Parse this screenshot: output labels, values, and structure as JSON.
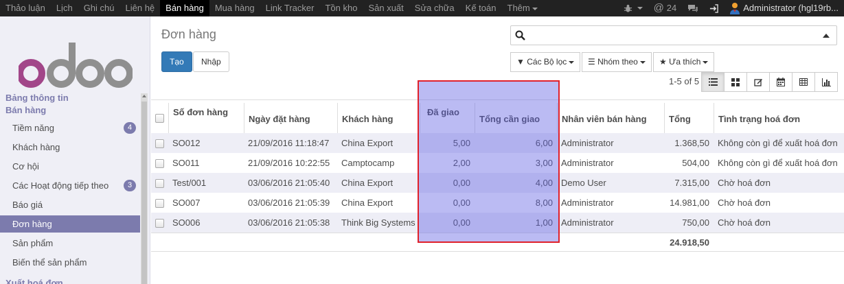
{
  "topmenu": {
    "items": [
      "Thảo luận",
      "Lịch",
      "Ghi chú",
      "Liên hệ",
      "Bán hàng",
      "Mua hàng",
      "Link Tracker",
      "Tồn kho",
      "Sản xuất",
      "Sửa chữa",
      "Kế toán",
      "Thêm"
    ],
    "active_index": 4,
    "messages_count": "24",
    "user": "Administrator (hgl19rb..."
  },
  "sidebar": {
    "sections": [
      "Bảng thông tin",
      "Bán hàng",
      "Xuất hoá đơn"
    ],
    "items": [
      {
        "label": "Tiềm năng",
        "badge": "4"
      },
      {
        "label": "Khách hàng"
      },
      {
        "label": "Cơ hội"
      },
      {
        "label": "Các Hoạt động tiếp theo",
        "badge": "3"
      },
      {
        "label": "Báo giá"
      },
      {
        "label": "Đơn hàng",
        "active": true
      },
      {
        "label": "Sản phẩm"
      },
      {
        "label": "Biến thể sản phẩm"
      }
    ]
  },
  "control": {
    "title": "Đơn hàng",
    "create_label": "Tạo",
    "import_label": "Nhập",
    "filters_label": "Các Bộ lọc",
    "groupby_label": "Nhóm theo",
    "favorites_label": "Ưa thích",
    "pager": "1-5 of 5"
  },
  "table": {
    "headers": [
      "Số đơn hàng",
      "Ngày đặt hàng",
      "Khách hàng",
      "Đã giao",
      "Tổng cần giao",
      "Nhân viên bán hàng",
      "Tổng",
      "Tình trạng hoá đơn"
    ],
    "rows": [
      {
        "number": "SO012",
        "date": "21/09/2016 11:18:47",
        "customer": "China Export",
        "delivered": "5,00",
        "to_deliver": "6,00",
        "salesperson": "Administrator",
        "total": "1.368,50",
        "status": "Không còn gì để xuất hoá đơn"
      },
      {
        "number": "SO011",
        "date": "21/09/2016 10:22:55",
        "customer": "Camptocamp",
        "delivered": "2,00",
        "to_deliver": "3,00",
        "salesperson": "Administrator",
        "total": "504,00",
        "status": "Không còn gì để xuất hoá đơn"
      },
      {
        "number": "Test/001",
        "date": "03/06/2016 21:05:40",
        "customer": "China Export",
        "delivered": "0,00",
        "to_deliver": "4,00",
        "salesperson": "Demo User",
        "total": "7.315,00",
        "status": "Chờ hoá đơn"
      },
      {
        "number": "SO007",
        "date": "03/06/2016 21:05:39",
        "customer": "China Export",
        "delivered": "0,00",
        "to_deliver": "8,00",
        "salesperson": "Administrator",
        "total": "14.981,00",
        "status": "Chờ hoá đơn"
      },
      {
        "number": "SO006",
        "date": "03/06/2016 21:05:38",
        "customer": "Think Big Systems",
        "delivered": "0,00",
        "to_deliver": "1,00",
        "salesperson": "Administrator",
        "total": "750,00",
        "status": "Chờ hoá đơn"
      }
    ],
    "grand_total": "24.918,50"
  },
  "colors": {
    "brand": "#7c7bad",
    "primary": "#337ab7",
    "highlight_border": "#e0202a"
  }
}
